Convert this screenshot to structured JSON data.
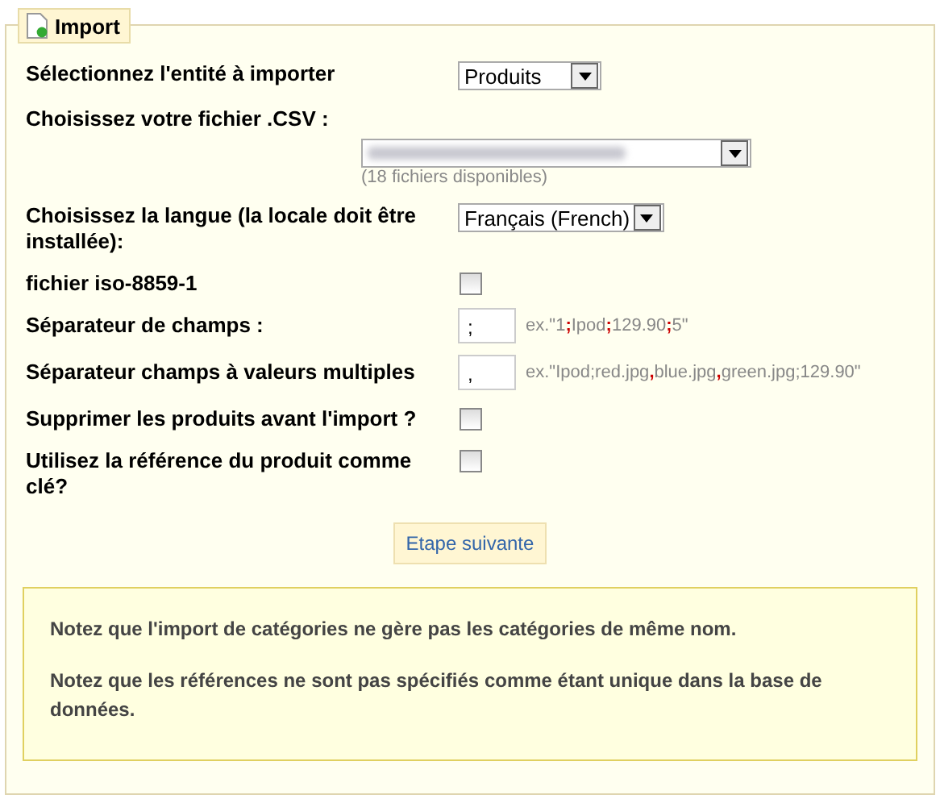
{
  "panel": {
    "title": "Import"
  },
  "fields": [
    {
      "kind": "select",
      "label": "Sélectionnez l'entité à importer",
      "value": "Produits"
    },
    {
      "kind": "file-select",
      "label": "Choisissez votre fichier .CSV :",
      "note": "(18 fichiers disponibles)"
    },
    {
      "kind": "select",
      "label": "Choisissez la langue (la locale doit être installée):",
      "value": "Français (French)"
    },
    {
      "kind": "checkbox",
      "label": "fichier iso-8859-1",
      "checked": false
    },
    {
      "kind": "text",
      "label": "Séparateur de champs :",
      "value": ";",
      "example": [
        {
          "text": "ex.\"1",
          "highlight": false
        },
        {
          "text": ";",
          "highlight": true
        },
        {
          "text": "Ipod",
          "highlight": false
        },
        {
          "text": ";",
          "highlight": true
        },
        {
          "text": "129.90",
          "highlight": false
        },
        {
          "text": ";",
          "highlight": true
        },
        {
          "text": "5\"",
          "highlight": false
        }
      ]
    },
    {
      "kind": "text",
      "label": "Séparateur champs à valeurs multiples",
      "value": ",",
      "example": [
        {
          "text": "ex.\"Ipod;red.jpg",
          "highlight": false
        },
        {
          "text": ",",
          "highlight": true
        },
        {
          "text": "blue.jpg",
          "highlight": false
        },
        {
          "text": ",",
          "highlight": true
        },
        {
          "text": "green.jpg;129.90\"",
          "highlight": false
        }
      ]
    },
    {
      "kind": "checkbox",
      "label": "Supprimer les produits avant l'import ?",
      "checked": false
    },
    {
      "kind": "checkbox",
      "label": "Utilisez la référence du produit comme clé?",
      "checked": false
    }
  ],
  "button": "Etape suivante",
  "notices": [
    "Notez que l'import de catégories ne gère pas les catégories de même nom.",
    "Notez que les références ne sont pas spécifiés comme étant unique dans la base de données."
  ]
}
